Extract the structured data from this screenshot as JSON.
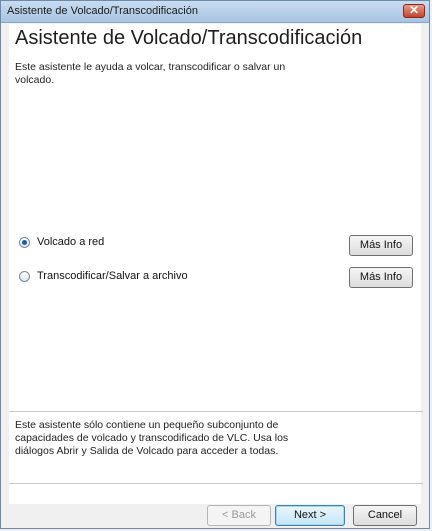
{
  "window": {
    "title": "Asistente de Volcado/Transcodificación",
    "close_glyph": "✕"
  },
  "page": {
    "heading": "Asistente de Volcado/Transcodificación",
    "intro": "Este asistente le ayuda a volcar, transcodificar o salvar un volcado."
  },
  "options": [
    {
      "label": "Volcado a red",
      "selected": true,
      "info_button": "Más Info"
    },
    {
      "label": "Transcodificar/Salvar a archivo",
      "selected": false,
      "info_button": "Más Info"
    }
  ],
  "footer_note": "Este asistente sólo contiene un pequeño subconjunto de capacidades de volcado y transcodificado de VLC. Usa los diálogos Abrir y Salida de Volcado para acceder a todas.",
  "buttons": {
    "back": "< Back",
    "next": "Next >",
    "cancel": "Cancel"
  },
  "icons": [
    "close-icon",
    "radio-icon"
  ]
}
